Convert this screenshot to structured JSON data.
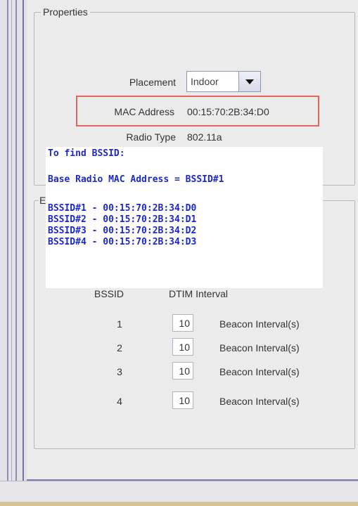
{
  "properties": {
    "title": "Properties",
    "placement_label": "Placement",
    "placement_value": "Indoor",
    "mac_label": "MAC Address",
    "mac_value": "00:15:70:2B:34:D0",
    "radio_type_label": "Radio Type",
    "radio_type_value": "802.11a"
  },
  "second_group": {
    "title_fragment": "E"
  },
  "callout": {
    "heading": "To find BSSID:",
    "formula": "Base Radio MAC Address = BSSID#1",
    "lines": [
      "BSSID#1 - 00:15:70:2B:34:D0",
      "BSSID#2 - 00:15:70:2B:34:D1",
      "BSSID#3 - 00:15:70:2B:34:D2",
      "BSSID#4 - 00:15:70:2B:34:D3"
    ],
    "text_color": "#1c29c9"
  },
  "bssid_table": {
    "col_bssid": "BSSID",
    "col_dtim": "DTIM Interval",
    "rows": [
      {
        "bssid": "1",
        "dtim": "10",
        "beacon_label": "Beacon Interval(s)"
      },
      {
        "bssid": "2",
        "dtim": "10",
        "beacon_label": "Beacon Interval(s)"
      },
      {
        "bssid": "3",
        "dtim": "10",
        "beacon_label": "Beacon Interval(s)"
      },
      {
        "bssid": "4",
        "dtim": "10",
        "beacon_label": "Beacon Interval(s)"
      }
    ]
  },
  "icons": {
    "combo_arrow": "chevron-down-icon"
  },
  "colors": {
    "highlight_border": "#e3655b",
    "panel_background": "#ecebec"
  }
}
